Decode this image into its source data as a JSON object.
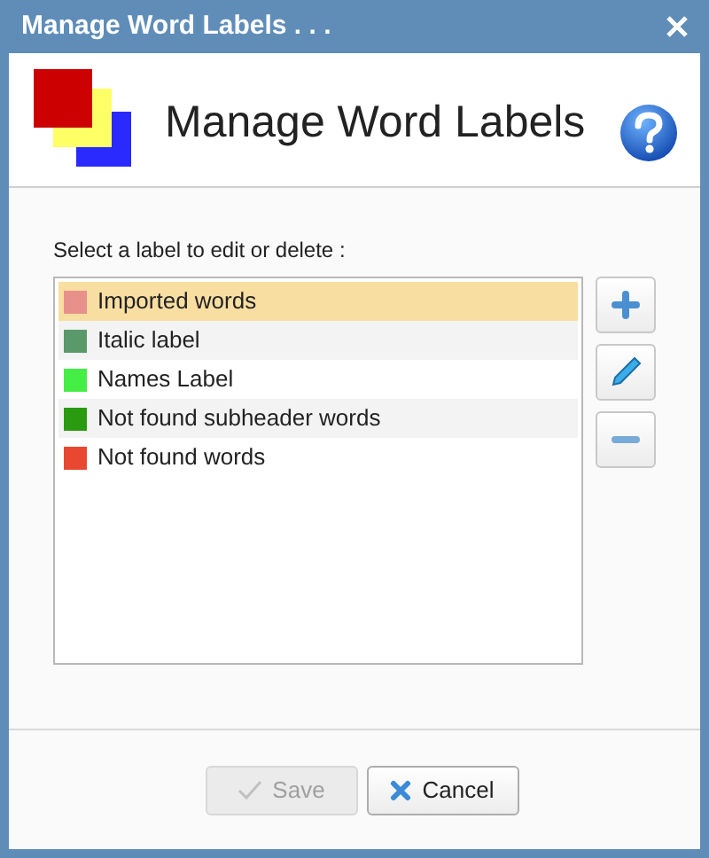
{
  "window": {
    "title": "Manage Word Labels . . ."
  },
  "header": {
    "heading": "Manage Word Labels"
  },
  "prompt": "Select a label to edit or delete :",
  "labels": [
    {
      "name": "Imported words",
      "color": "#e8908a",
      "selected": true
    },
    {
      "name": "Italic label",
      "color": "#5a9a6a",
      "selected": false
    },
    {
      "name": "Names Label",
      "color": "#44ee44",
      "selected": false
    },
    {
      "name": "Not found subheader words",
      "color": "#2a9a10",
      "selected": false
    },
    {
      "name": "Not found words",
      "color": "#e84830",
      "selected": false
    }
  ],
  "buttons": [
    {
      "label": "Save",
      "kind": "save",
      "disabled": true
    },
    {
      "label": "Cancel",
      "kind": "cancel",
      "disabled": false
    }
  ]
}
